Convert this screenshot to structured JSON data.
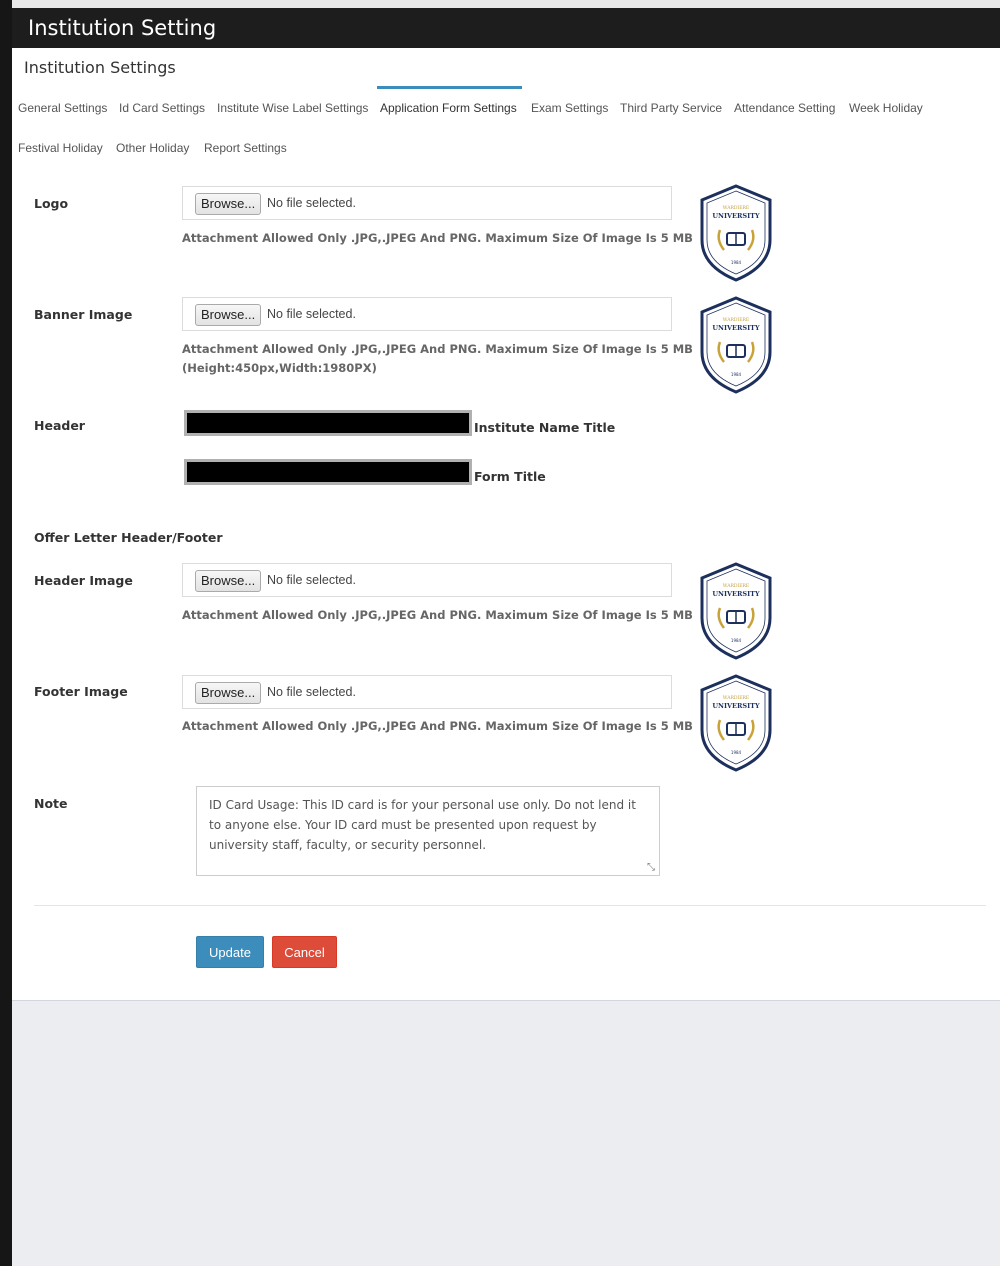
{
  "window": {
    "title": "Institution Setting"
  },
  "panel": {
    "title": "Institution Settings"
  },
  "tabs": [
    {
      "label": "General Settings"
    },
    {
      "label": "Id Card Settings"
    },
    {
      "label": "Institute Wise Label Settings"
    },
    {
      "label": "Application Form Settings",
      "active": true
    },
    {
      "label": "Exam Settings"
    },
    {
      "label": "Third Party Service"
    },
    {
      "label": "Attendance Setting"
    },
    {
      "label": "Week Holiday"
    },
    {
      "label": "Festival Holiday"
    },
    {
      "label": "Other Holiday"
    },
    {
      "label": "Report Settings"
    }
  ],
  "form": {
    "logo": {
      "label": "Logo",
      "browse": "Browse...",
      "file_status": "No file selected.",
      "hint": "Attachment Allowed Only .JPG,.JPEG And PNG. Maximum Size Of Image Is 5 MB"
    },
    "banner": {
      "label": "Banner Image",
      "browse": "Browse...",
      "file_status": "No file selected.",
      "hint": "Attachment Allowed Only .JPG,.JPEG And PNG. Maximum Size Of Image Is 5 MB",
      "hint2": "(Height:450px,Width:1980PX)"
    },
    "header": {
      "label": "Header",
      "institute_name_label": "Institute Name Title",
      "form_title_label": "Form Title"
    },
    "offer_section": {
      "label": "Offer Letter Header/Footer"
    },
    "header_image": {
      "label": "Header Image",
      "browse": "Browse...",
      "file_status": "No file selected.",
      "hint": "Attachment Allowed Only .JPG,.JPEG And PNG. Maximum Size Of Image Is 5 MB"
    },
    "footer_image": {
      "label": "Footer Image",
      "browse": "Browse...",
      "file_status": "No file selected.",
      "hint": "Attachment Allowed Only .JPG,.JPEG And PNG. Maximum Size Of Image Is 5 MB"
    },
    "note": {
      "label": "Note",
      "value": "ID Card Usage: This ID card is for your personal use only. Do not lend it to anyone else. Your ID card must be presented upon request by university staff, faculty, or security personnel."
    }
  },
  "buttons": {
    "update": "Update",
    "cancel": "Cancel"
  },
  "logo_image": {
    "top_text": "WARDIERE",
    "name": "UNIVERSITY",
    "year": "1984"
  },
  "colors": {
    "primary": "#3c8dbc",
    "danger": "#dd4b39",
    "titlebar": "#1d1d1d",
    "logo_navy": "#1d2f5c",
    "logo_gold": "#c9a23a"
  }
}
